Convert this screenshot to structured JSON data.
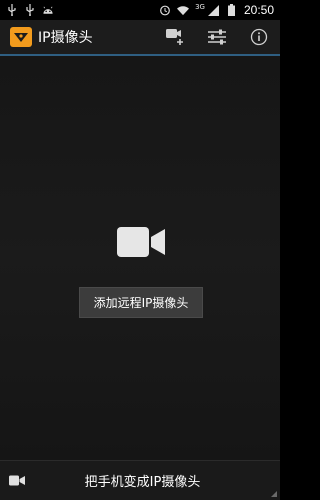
{
  "status_bar": {
    "time": "20:50",
    "network": "3G",
    "icons": [
      "usb-icon",
      "usb-debug-icon",
      "android-icon",
      "alarm-icon",
      "wifi-icon",
      "signal-icon",
      "battery-icon"
    ]
  },
  "action_bar": {
    "title": "IP摄像头",
    "actions": [
      "add-camera-icon",
      "settings-sliders-icon",
      "info-icon"
    ]
  },
  "main": {
    "add_remote_label": "添加远程IP摄像头"
  },
  "bottom_bar": {
    "label": "把手机变成IP摄像头"
  },
  "colors": {
    "accent": "#2f5f82",
    "logo": "#f29b1d"
  }
}
